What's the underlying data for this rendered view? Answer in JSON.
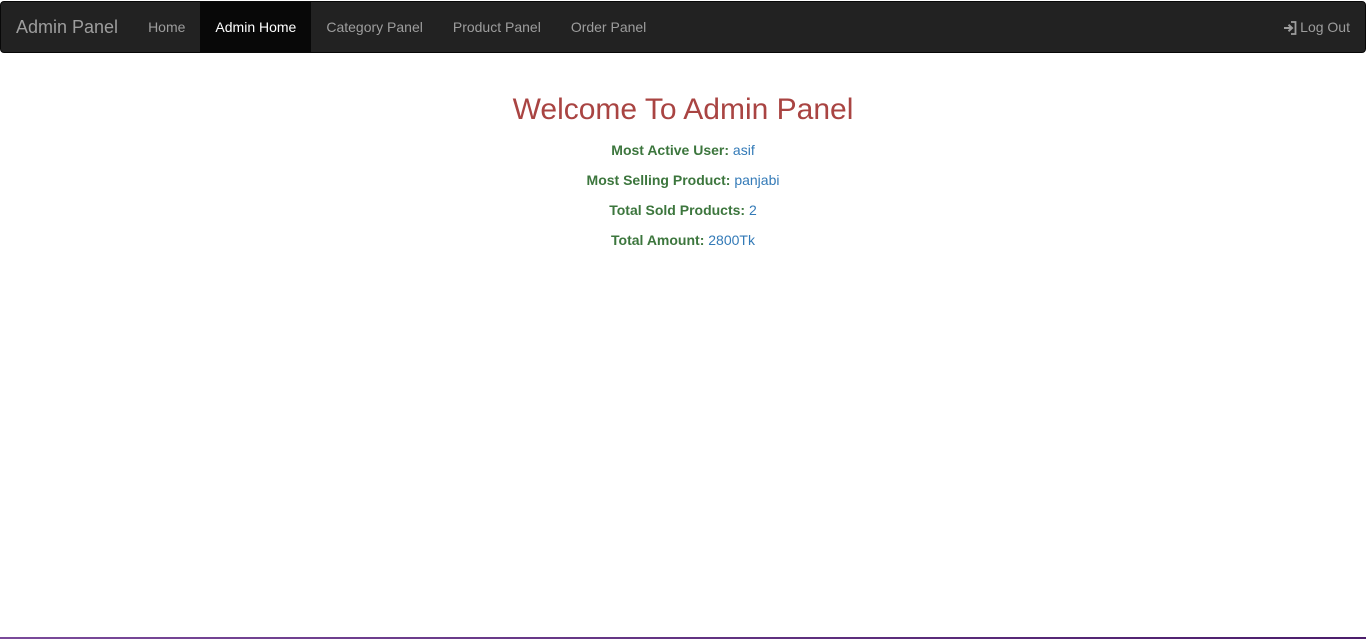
{
  "navbar": {
    "brand": "Admin Panel",
    "links": [
      {
        "label": "Home"
      },
      {
        "label": "Admin Home"
      },
      {
        "label": "Category Panel"
      },
      {
        "label": "Product Panel"
      },
      {
        "label": "Order Panel"
      }
    ],
    "active_link": "Admin Home",
    "logout": {
      "label": "Log Out",
      "icon": "log-in-icon"
    }
  },
  "main": {
    "title": "Welcome To Admin Panel",
    "stats": [
      {
        "label": "Most Active User:",
        "value": "asif"
      },
      {
        "label": "Most Selling Product:",
        "value": "panjabi"
      },
      {
        "label": "Total Sold Products:",
        "value": "2"
      },
      {
        "label": "Total Amount:",
        "value": "2800Tk"
      }
    ]
  },
  "colors": {
    "navbar_bg": "#222222",
    "active_bg": "#080808",
    "title": "#a94442",
    "label": "#3c763d",
    "value": "#337ab7"
  }
}
